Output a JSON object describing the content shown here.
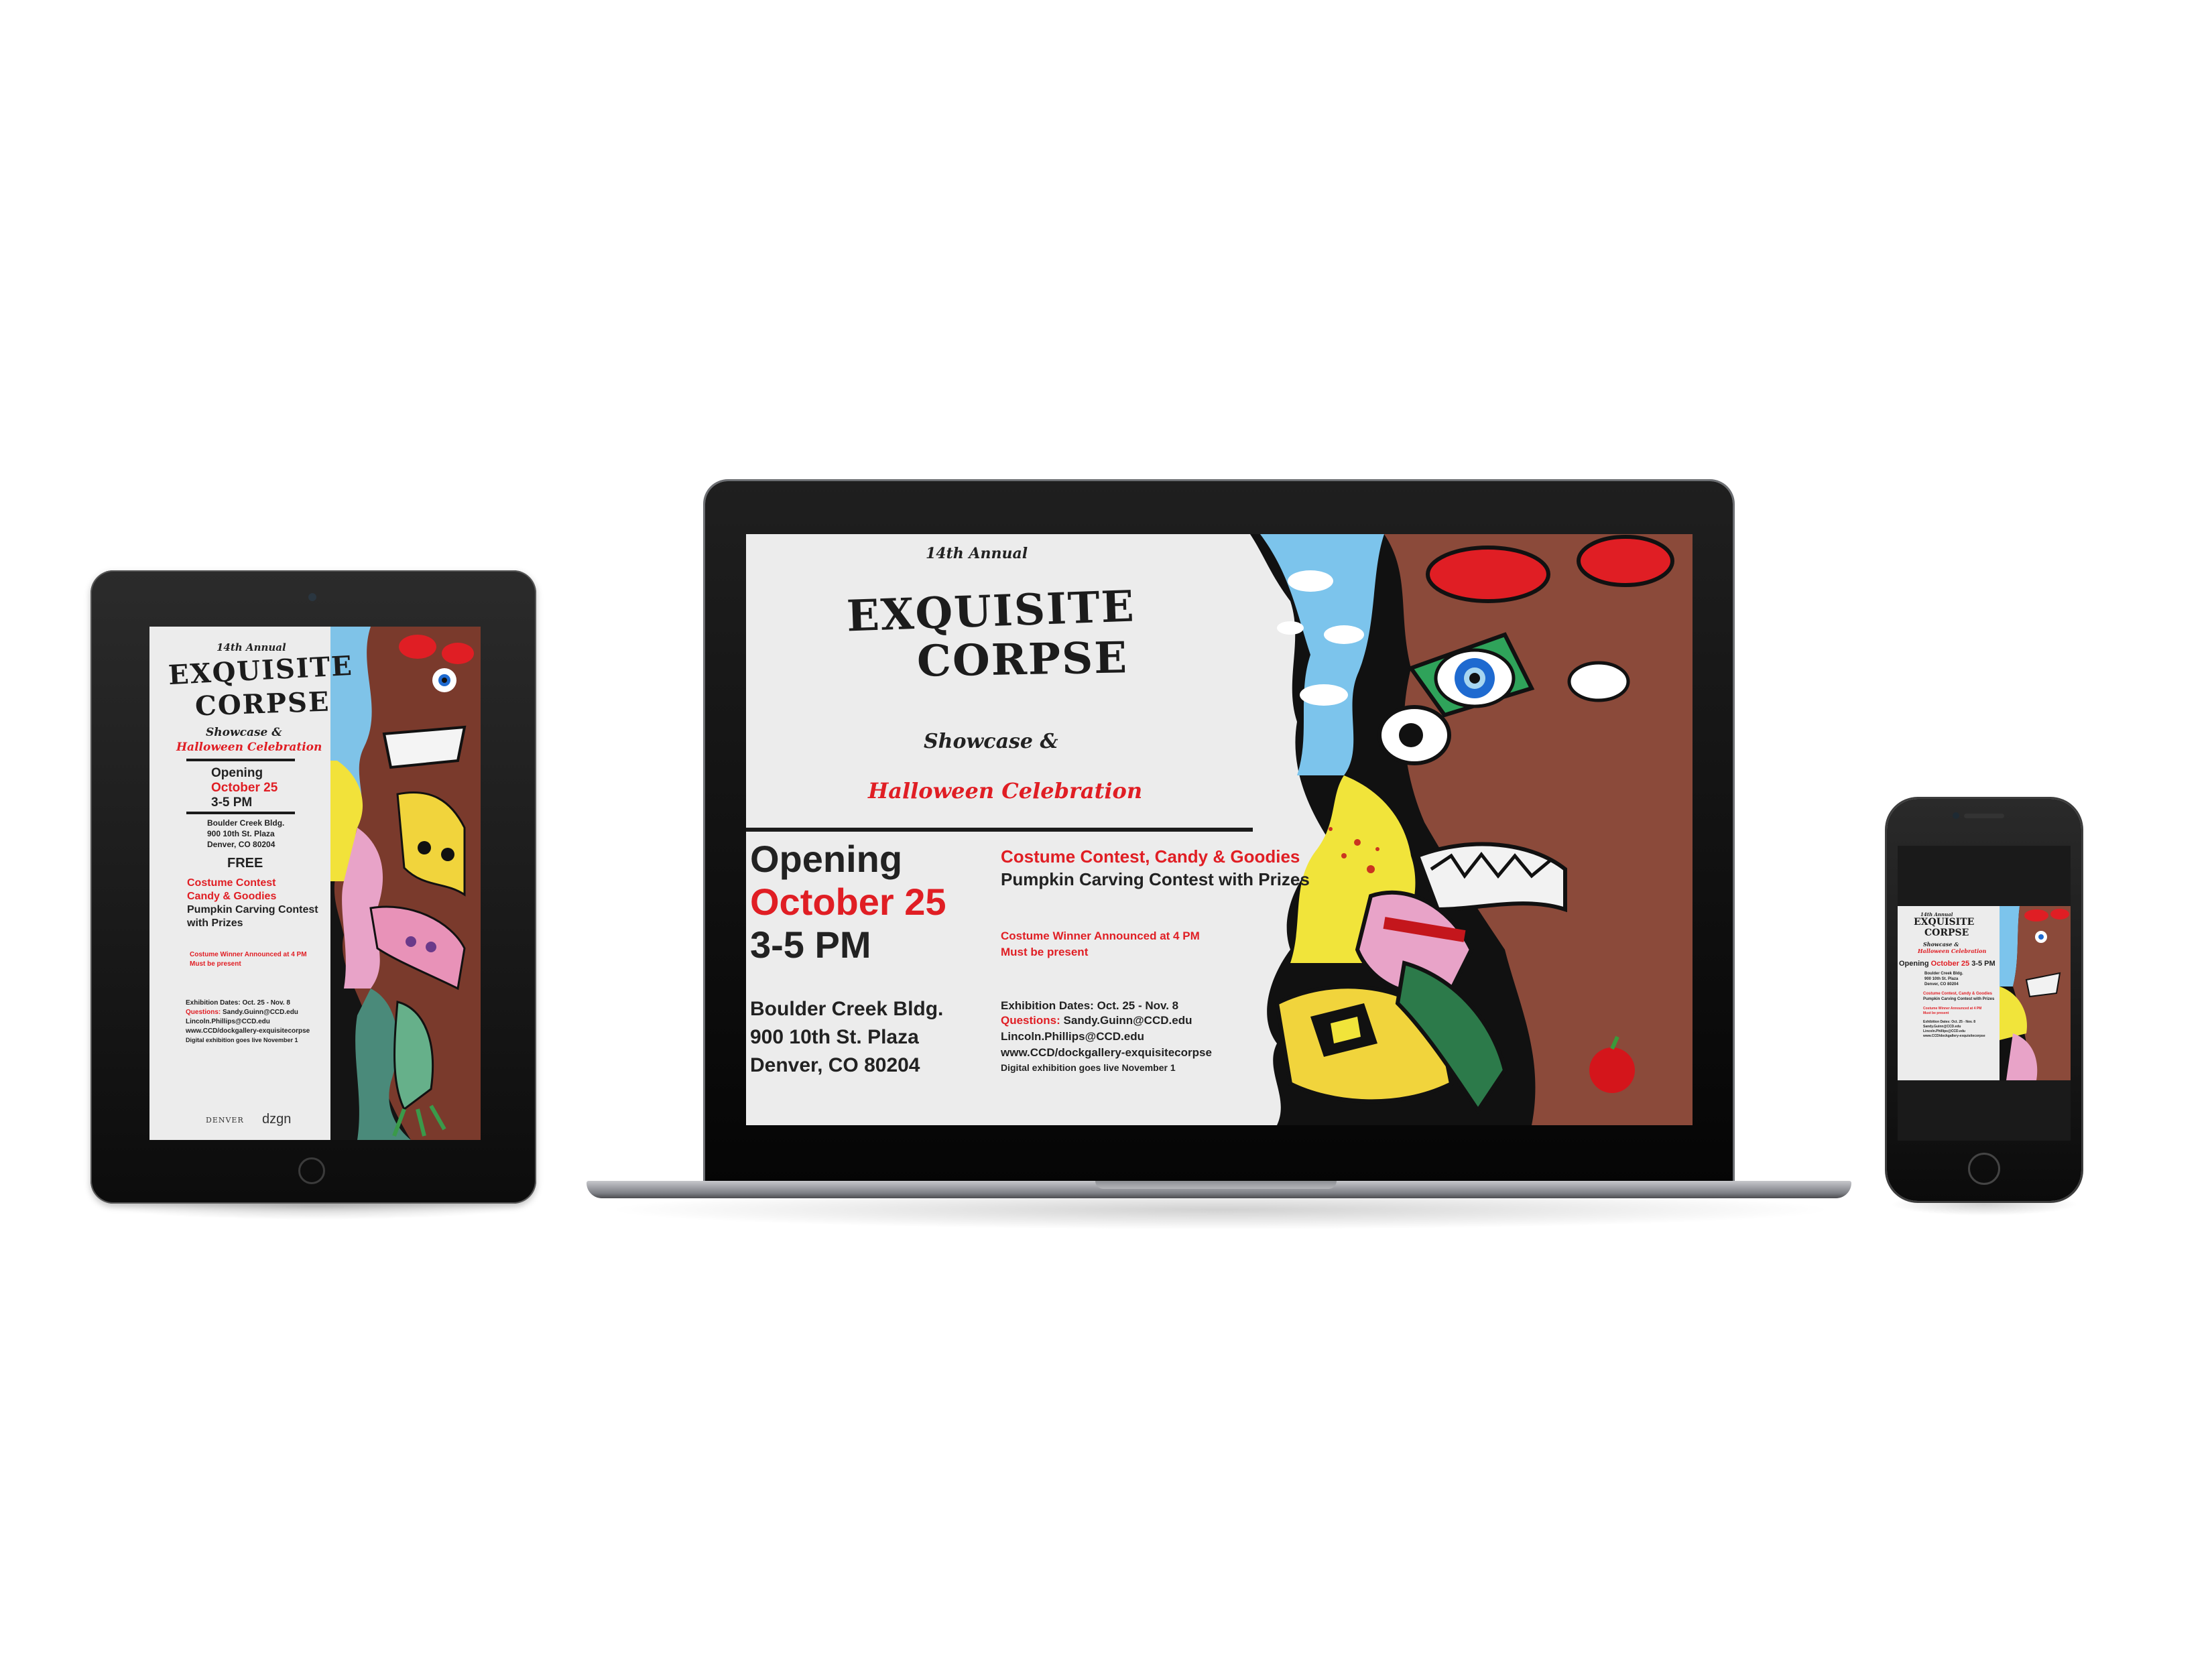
{
  "poster": {
    "annual": "14th Annual",
    "title_line1": "EXQUISITE",
    "title_line2": "CORPSE",
    "subtitle": "Showcase &",
    "celebration": "Halloween Celebration",
    "opening_label": "Opening",
    "opening_date": "October 25",
    "opening_time": "3-5 PM",
    "location_line1": "Boulder Creek Bldg.",
    "location_line2": "900 10th St. Plaza",
    "location_line3": "Denver, CO 80204",
    "location_line3_short": "Denver, CO 80204",
    "free": "FREE",
    "contest": "Costume Contest, Candy & Goodies",
    "contest_a": "Costume Contest",
    "contest_b": "Candy & Goodies",
    "pumpkin": "Pumpkin Carving Contest with Prizes",
    "pumpkin_a": "Pumpkin Carving Contest",
    "pumpkin_b": "with Prizes",
    "winner": "Costume Winner Announced at 4 PM",
    "present": "Must be present",
    "exhibition": "Exhibition Dates: Oct. 25 - Nov. 8",
    "questions_label": "Questions:",
    "contact1": "Sandy.Guinn@CCD.edu",
    "contact2": "Lincoln.Phillips@CCD.edu",
    "website": "www.CCD/dockgallery-exquisitecorpse",
    "digital": "Digital exhibition goes live November 1",
    "logo1": "DENVER",
    "logo2": "dzgn"
  },
  "colors": {
    "red": "#e01e24",
    "poster_bg": "#ececec",
    "text_dark": "#222222",
    "device_black": "#0c0c0c",
    "laptop_silver": "#9a9ca1"
  }
}
